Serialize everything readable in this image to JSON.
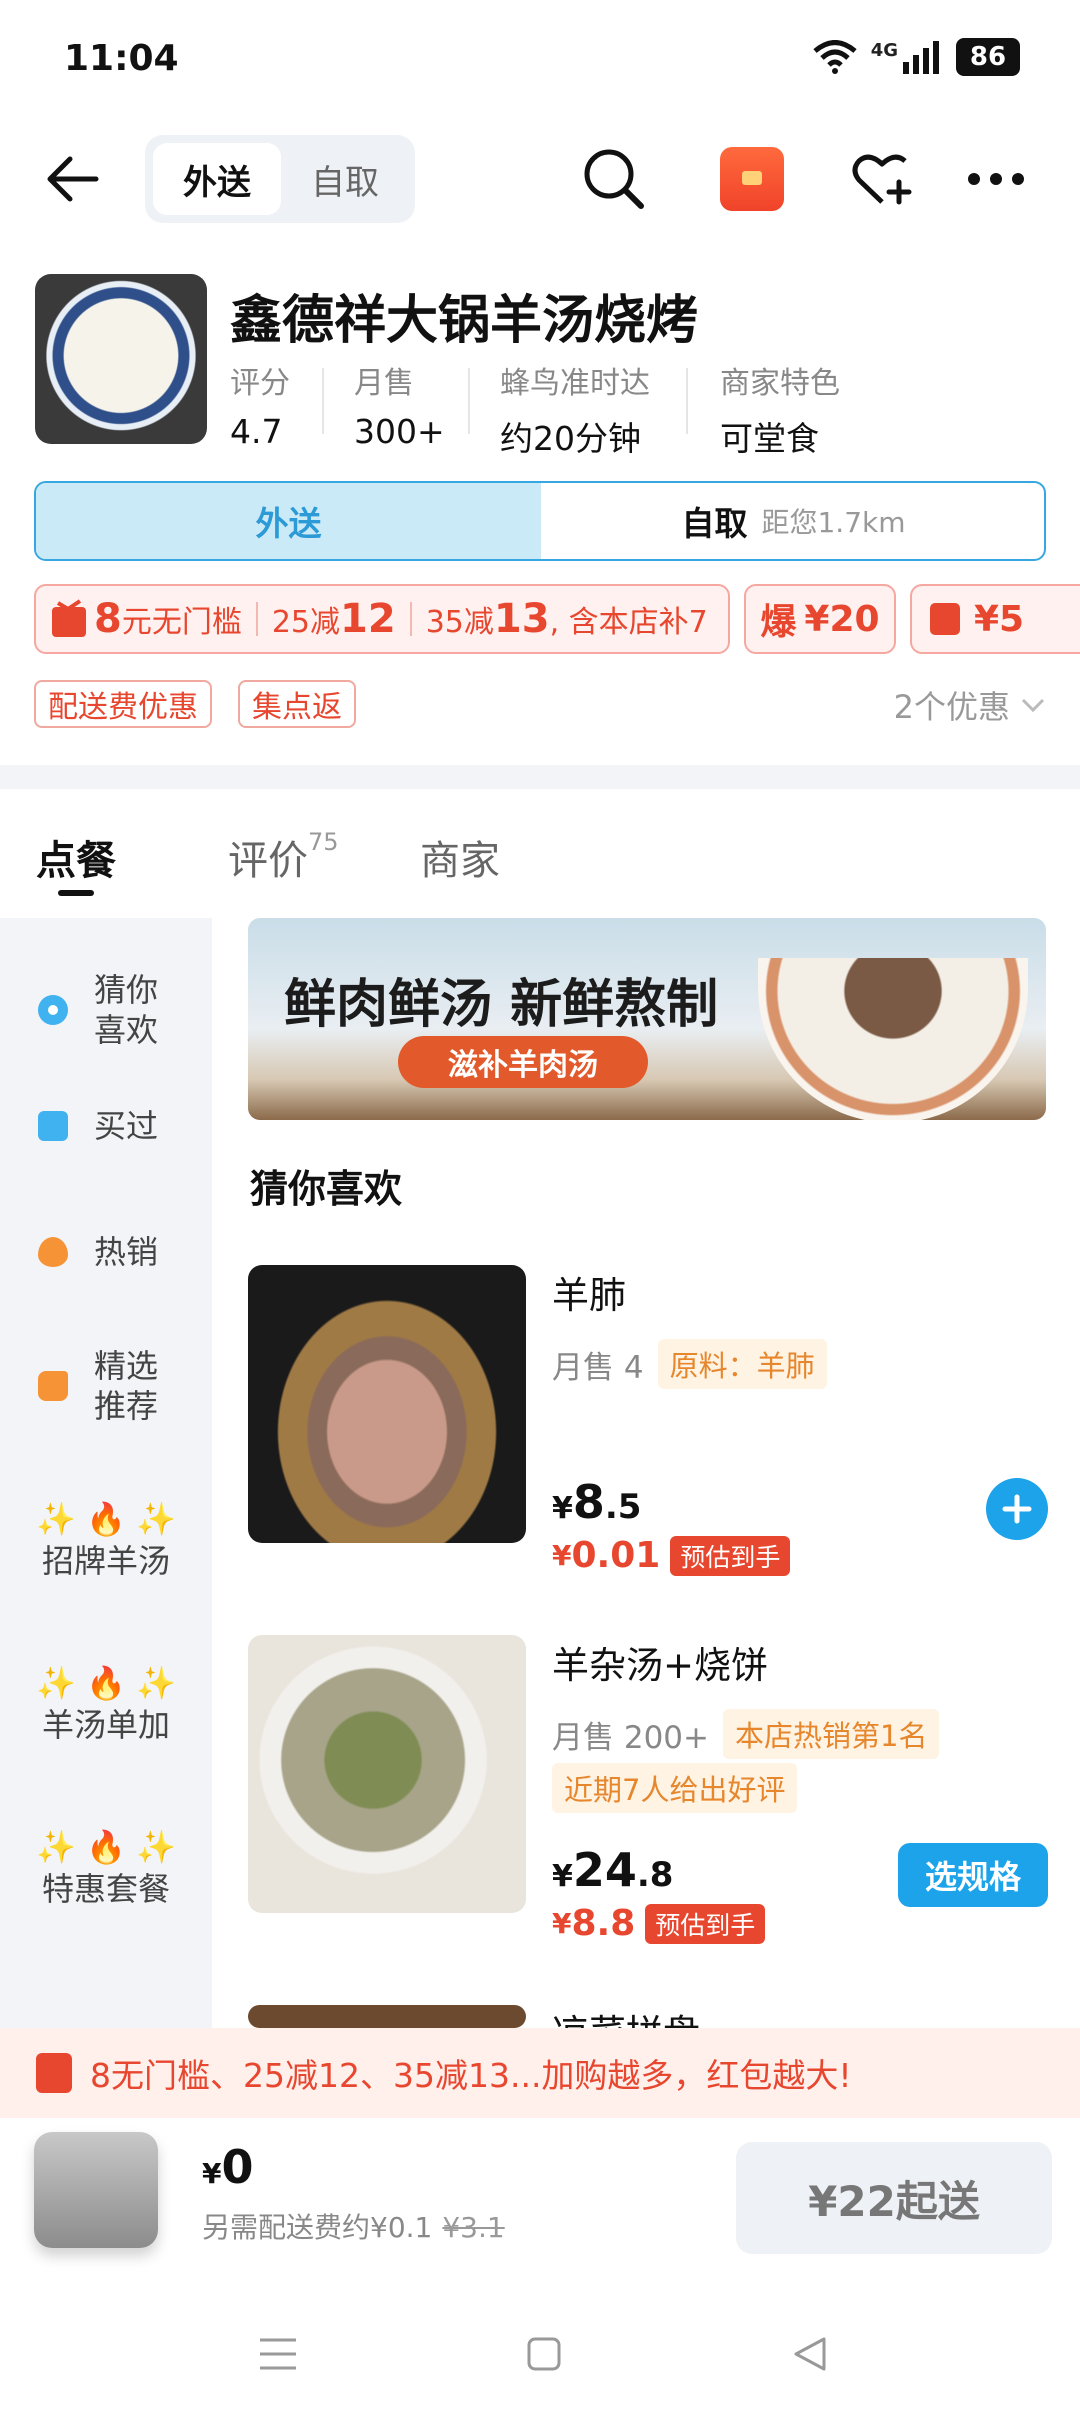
{
  "status_bar": {
    "time": "11:04",
    "network": "4G",
    "battery": "86"
  },
  "top_nav": {
    "tab_delivery": "外送",
    "tab_pickup": "自取"
  },
  "store": {
    "name": "鑫德祥大锅羊汤烧烤",
    "stats": [
      {
        "label": "评分",
        "value": "4.7"
      },
      {
        "label": "月售",
        "value": "300+"
      },
      {
        "label": "蜂鸟准时达",
        "value": "约20分钟"
      },
      {
        "label": "商家特色",
        "value": "可堂食"
      }
    ]
  },
  "modes": {
    "delivery": "外送",
    "pickup": "自取",
    "distance": "距您1.7km"
  },
  "promos": {
    "threshold_amount": "8",
    "threshold_text": "元无门槛",
    "discount1_prefix": "25减",
    "discount1_amount": "12",
    "discount2_prefix": "35减",
    "discount2_amount": "13",
    "discount2_suffix": ", 含本店补7",
    "hot_label": "爆",
    "hot_amount": "¥20",
    "redpacket_amount": "¥5"
  },
  "tags": {
    "delivery_fee": "配送费优惠",
    "points": "集点返",
    "offers": "2个优惠"
  },
  "tabs": {
    "order": "点餐",
    "reviews": "评价",
    "reviews_count": "75",
    "merchant": "商家"
  },
  "sidebar": {
    "items": [
      {
        "label": "猜你喜欢"
      },
      {
        "label": "买过"
      },
      {
        "label": "热销"
      },
      {
        "label": "精选推荐"
      },
      {
        "emoji": "✨ 🔥 ✨",
        "label": "招牌羊汤"
      },
      {
        "emoji": "✨ 🔥 ✨",
        "label": "羊汤单加"
      },
      {
        "emoji": "✨ 🔥 ✨",
        "label": "特惠套餐"
      }
    ]
  },
  "banner": {
    "title": "鲜肉鲜汤 新鲜熬制",
    "subtitle": "滋补羊肉汤"
  },
  "section_title": "猜你喜欢",
  "items": [
    {
      "name": "羊肺",
      "sales": "月售 4",
      "tag": "原料：羊肺",
      "price_yen": "¥",
      "price_int": "8",
      "price_dec": ".5",
      "est_price": "0.01",
      "est_label": "预估到手"
    },
    {
      "name": "羊杂汤+烧饼",
      "sales": "月售 200+",
      "tag": "本店热销第1名",
      "tag2": "近期7人给出好评",
      "price_yen": "¥",
      "price_int": "24",
      "price_dec": ".8",
      "est_price": "8.8",
      "est_label": "预估到手",
      "button": "选规格"
    }
  ],
  "next_item_partial": "凉菜拼盘",
  "coupon_bar": {
    "text": "8无门槛、25减12、35减13...加购越多，红包越大!"
  },
  "cart": {
    "yen": "¥",
    "total": "0",
    "fee_text": "另需配送费约¥0.1",
    "fee_original": "¥3.1",
    "checkout": "¥22起送"
  },
  "colors": {
    "accent": "#1da3ea",
    "promo_red": "#e8472f",
    "tag_orange": "#e6872d"
  }
}
